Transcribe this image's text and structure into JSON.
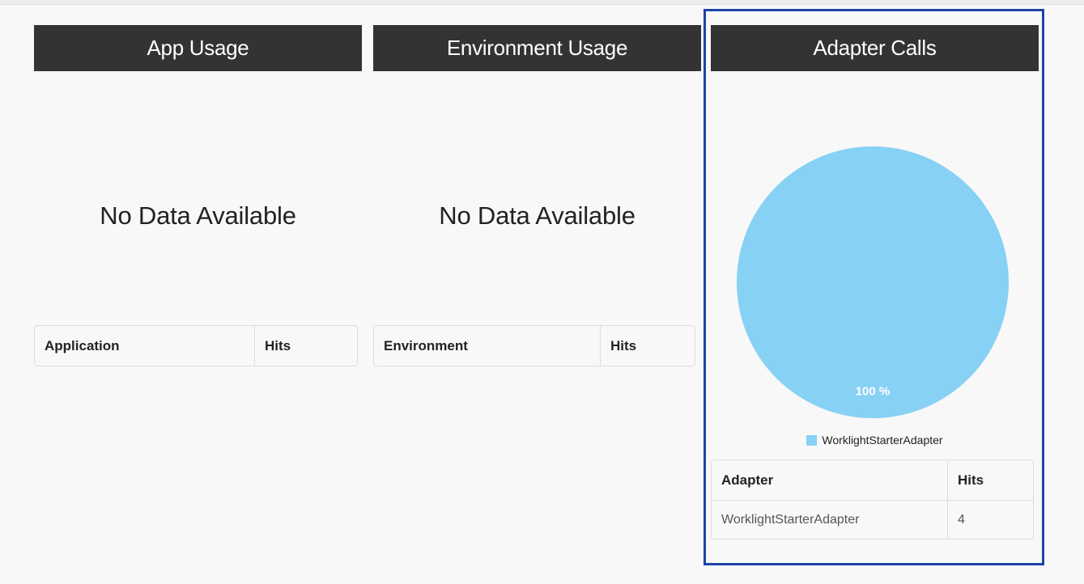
{
  "panels": [
    {
      "title": "App Usage",
      "empty_text": "No Data Available",
      "table": {
        "columns": [
          "Application",
          "Hits"
        ],
        "rows": []
      }
    },
    {
      "title": "Environment Usage",
      "empty_text": "No Data Available",
      "table": {
        "columns": [
          "Environment",
          "Hits"
        ],
        "rows": []
      }
    },
    {
      "title": "Adapter Calls",
      "table": {
        "columns": [
          "Adapter",
          "Hits"
        ],
        "rows": [
          {
            "adapter": "WorklightStarterAdapter",
            "hits": "4"
          }
        ]
      }
    }
  ],
  "chart_data": {
    "type": "pie",
    "slices": [
      {
        "label": "WorklightStarterAdapter",
        "value": 100,
        "display": "100 %",
        "color": "#87d1f5"
      }
    ],
    "legend": [
      "WorklightStarterAdapter"
    ],
    "legend_placement": "bottom"
  },
  "colors": {
    "header_bg": "#333333",
    "highlight_border": "#1c44a8",
    "pie_slice": "#87d1f5"
  }
}
